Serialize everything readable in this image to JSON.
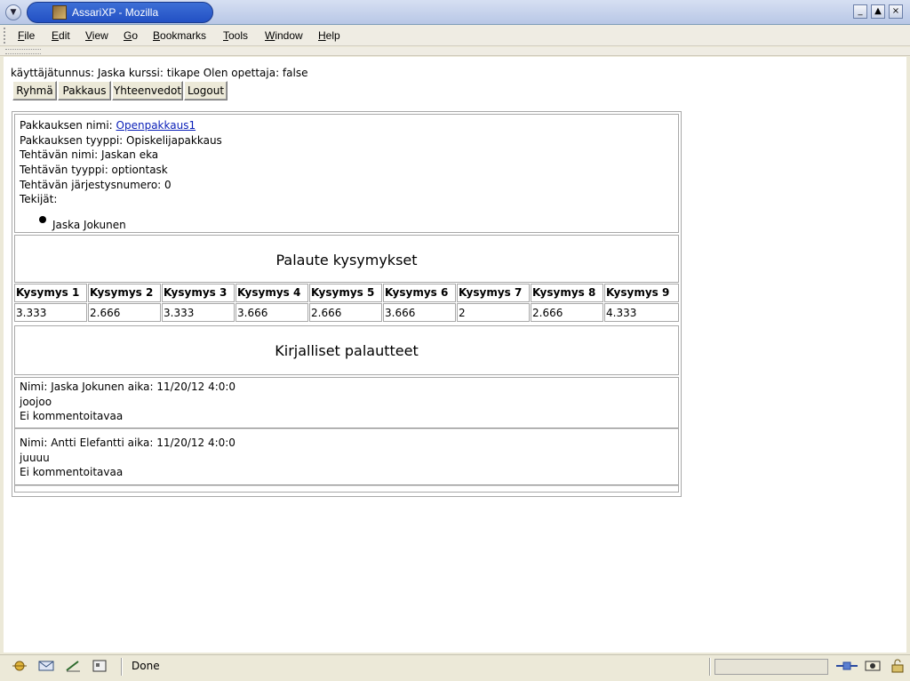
{
  "window": {
    "title": "AssariXP - Mozilla",
    "controls": {
      "minimize": "_",
      "maximize": "▲",
      "close": "×"
    }
  },
  "menu": {
    "items": [
      {
        "label": "File",
        "underline": "F",
        "rest": "ile"
      },
      {
        "label": "Edit",
        "underline": "E",
        "rest": "dit"
      },
      {
        "label": "View",
        "underline": "V",
        "rest": "iew"
      },
      {
        "label": "Go",
        "underline": "G",
        "rest": "o"
      },
      {
        "label": "Bookmarks",
        "underline": "B",
        "rest": "ookmarks"
      },
      {
        "label": "Tools",
        "underline": "T",
        "rest": "ools"
      },
      {
        "label": "Window",
        "underline": "W",
        "rest": "indow"
      },
      {
        "label": "Help",
        "underline": "H",
        "rest": "elp"
      }
    ]
  },
  "session": {
    "line": "käyttäjätunnus: Jaska kurssi: tikape Olen opettaja: false"
  },
  "nav": {
    "buttons": [
      "Ryhmä",
      "Pakkaus",
      "Yhteenvedot",
      "Logout"
    ]
  },
  "package": {
    "name_label": "Pakkauksen nimi: ",
    "name_link": "Openpakkaus1",
    "type_line": "Pakkauksen tyyppi: Opiskelijapakkaus",
    "task_name_line": "Tehtävän nimi: Jaskan eka",
    "task_type_line": "Tehtävän tyyppi: optiontask",
    "task_order_line": "Tehtävän järjestysnumero: 0",
    "authors_label": "Tekijät:",
    "authors": [
      "Jaska Jokunen"
    ]
  },
  "feedback_questions": {
    "title": "Palaute kysymykset",
    "headers": [
      "Kysymys 1",
      "Kysymys 2",
      "Kysymys 3",
      "Kysymys 4",
      "Kysymys 5",
      "Kysymys 6",
      "Kysymys 7",
      "Kysymys 8",
      "Kysymys 9"
    ],
    "values": [
      "3.333",
      "2.666",
      "3.333",
      "3.666",
      "2.666",
      "3.666",
      "2",
      "2.666",
      "4.333"
    ]
  },
  "written_feedback": {
    "title": "Kirjalliset palautteet",
    "entries": [
      {
        "header": "Nimi: Jaska Jokunen aika: 11/20/12 4:0:0",
        "text": "joojoo",
        "comment": "Ei kommentoitavaa"
      },
      {
        "header": "Nimi: Antti Elefantti aika: 11/20/12 4:0:0",
        "text": "juuuu",
        "comment": "Ei kommentoitavaa"
      }
    ]
  },
  "status": {
    "text": "Done"
  }
}
